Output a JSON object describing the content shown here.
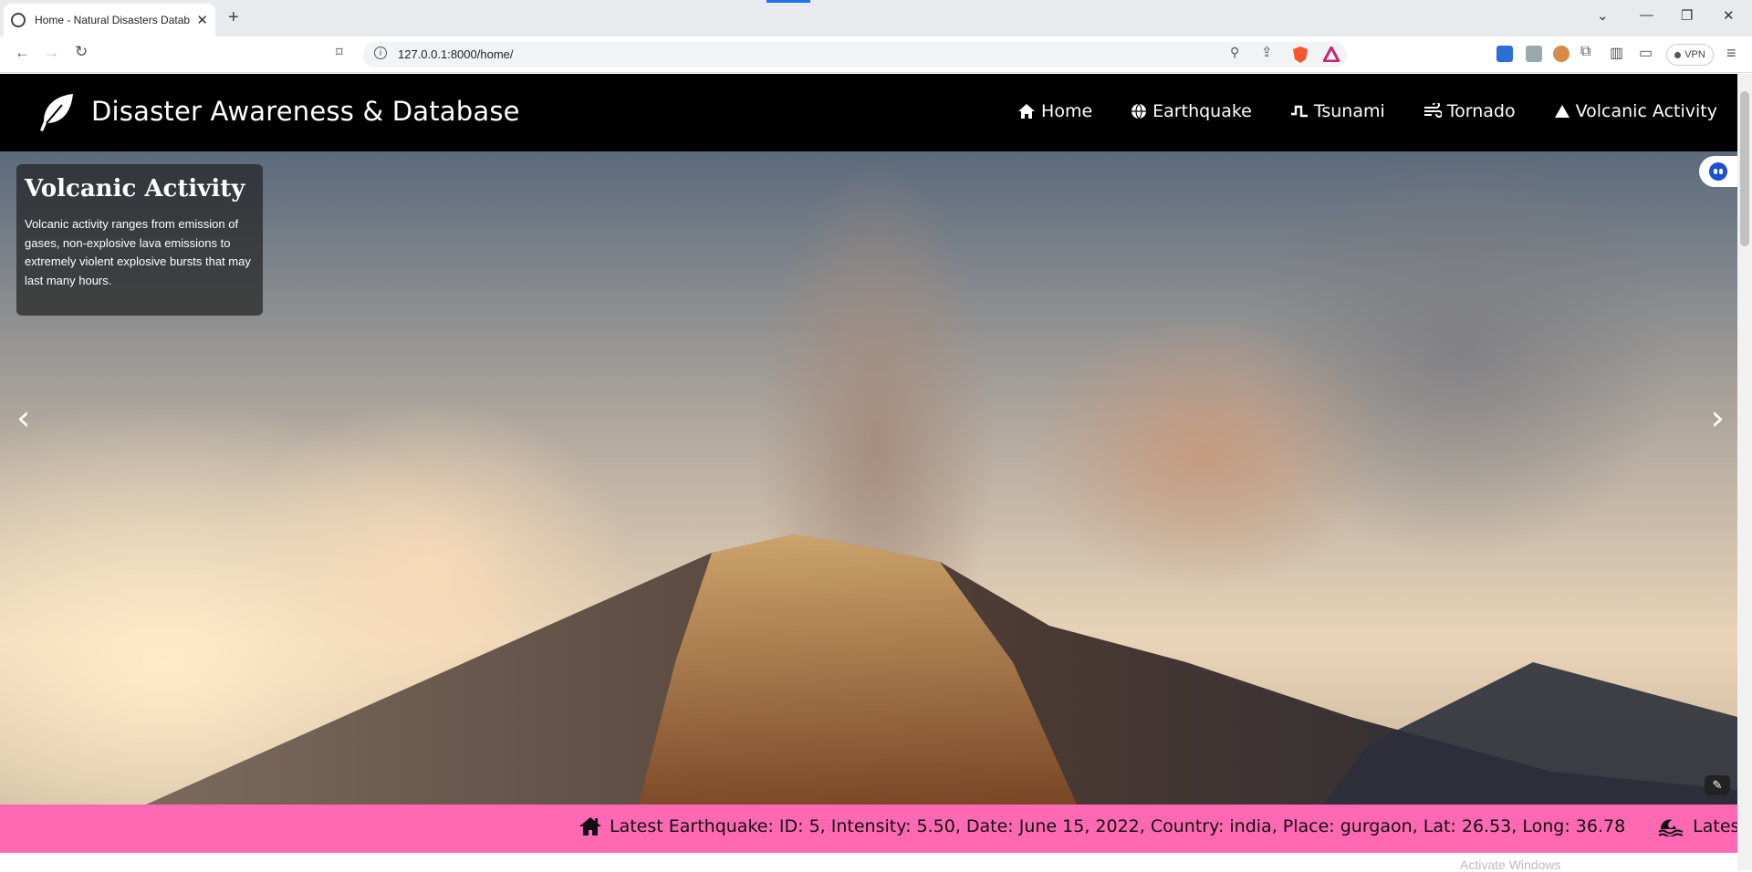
{
  "browser": {
    "tab_title": "Home - Natural Disasters Datab",
    "url": "127.0.0.1:8000/home/",
    "vpn_label": "VPN",
    "icons": [
      "back-icon",
      "forward-icon",
      "reload-icon",
      "bookmark-icon",
      "zoom-icon",
      "share-icon",
      "brave-shield-icon",
      "brave-rewards-icon",
      "extensions-icon",
      "sidebar-icon",
      "wallet-icon",
      "menu-icon"
    ]
  },
  "navbar": {
    "brand": "Disaster Awareness & Database",
    "links": [
      {
        "label": "Home",
        "icon": "home-icon"
      },
      {
        "label": "Earthquake",
        "icon": "globe-icon"
      },
      {
        "label": "Tsunami",
        "icon": "wave-icon"
      },
      {
        "label": "Tornado",
        "icon": "wind-icon"
      },
      {
        "label": "Volcanic Activity",
        "icon": "triangle-icon"
      }
    ]
  },
  "hero": {
    "caption_title": "Volcanic Activity",
    "caption_text": "Volcanic activity ranges from emission of gases, non-explosive lava emissions to extremely violent explosive bursts that may last many hours.",
    "prev_arrow": "‹",
    "next_arrow": "›"
  },
  "ticker": {
    "earthquake": "Latest Earthquake: ID: 5, Intensity: 5.50, Date: June 15, 2022, Country: india, Place: gurgaon, Lat: 26.53, Long: 36.78",
    "tsunami": "Latest Tsunami: I"
  },
  "footer_ghost": "Activate Windows",
  "colors": {
    "navbar_bg": "#000000",
    "ticker_bg": "#ff69b4",
    "caption_bg": "rgba(35,35,35,0.72)"
  }
}
